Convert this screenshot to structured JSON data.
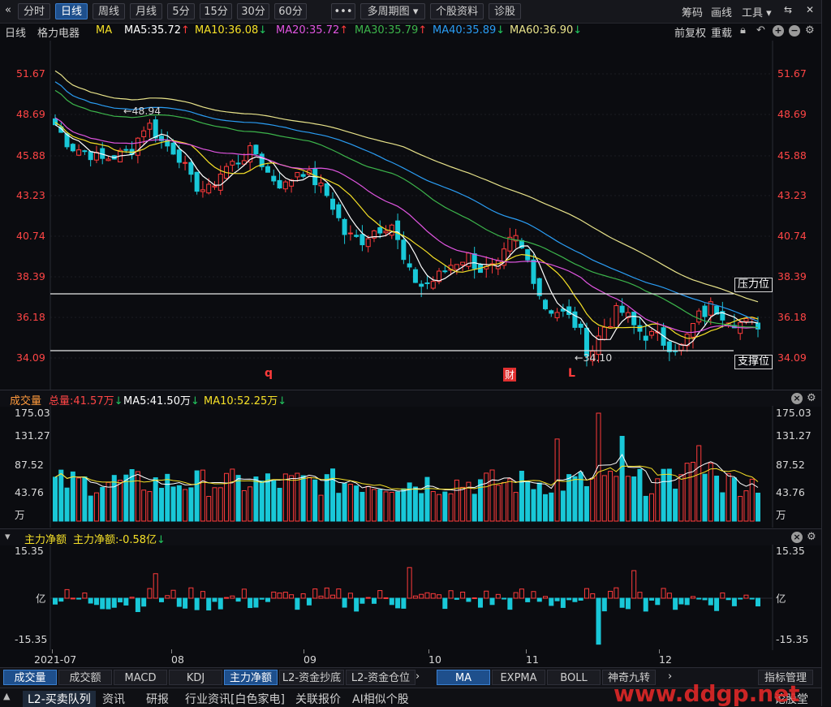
{
  "toolbar": {
    "back_icon": "«",
    "period_buttons": [
      "分时",
      "日线",
      "周线",
      "月线",
      "5分",
      "15分",
      "30分",
      "60分"
    ],
    "more_label": "•••",
    "multi_period_label": "多周期图",
    "stock_info_label": "个股资料",
    "diagnose_label": "诊股",
    "chips_label": "筹码",
    "draw_label": "画线",
    "tools_label": "工具",
    "active_period": "日线"
  },
  "ma_bar": {
    "period": "日线",
    "stock_name": "格力电器",
    "ma_label": "MA",
    "ma5": "MA5:35.72",
    "ma10": "MA10:36.08",
    "ma20": "MA20:35.72",
    "ma30": "MA30:35.79",
    "ma40": "MA40:35.89",
    "ma60": "MA60:36.90",
    "adjust_label": "前复权",
    "overlay_label": "重载",
    "colors": {
      "ma5": "#ffffff",
      "ma10": "#f5e027",
      "ma20": "#e055e0",
      "ma30": "#3cb44b",
      "ma40": "#2a9df4",
      "ma60": "#e8e38a"
    }
  },
  "price_axis": [
    "51.67",
    "48.69",
    "45.88",
    "43.23",
    "40.74",
    "38.39",
    "36.18",
    "34.09"
  ],
  "annotations": {
    "high_label": "←48.94",
    "low_label": "←34.10",
    "resistance_label": "压力位",
    "support_label": "支撑位",
    "marker_q": "q",
    "marker_cai": "财",
    "marker_L": "L"
  },
  "volume_panel": {
    "title": "成交量",
    "total": "总量:41.57万",
    "ma5": "MA5:41.50万",
    "ma10": "MA10:52.25万",
    "axis": [
      "175.03",
      "131.27",
      "87.52",
      "43.76",
      "万"
    ]
  },
  "flow_panel": {
    "title": "主力净额",
    "value": "主力净额:-0.58亿",
    "axis": [
      "15.35",
      "亿",
      "-15.35"
    ]
  },
  "date_axis": [
    "2021-07",
    "08",
    "09",
    "10",
    "11",
    "12"
  ],
  "indicator_tabs": [
    "成交量",
    "成交额",
    "MACD",
    "KDJ",
    "主力净额",
    "L2-资金抄底",
    "L2-资金仓位"
  ],
  "overlay_tabs": [
    "MA",
    "EXPMA",
    "BOLL",
    "神奇九转"
  ],
  "indicator_manage_label": "指标管理",
  "bottom_tabs": [
    "L2-买卖队列",
    "资讯",
    "研报",
    "行业资讯[白色家电]",
    "关联报价",
    "AI相似个股",
    "论股堂"
  ],
  "watermark": "www.ddgp.net",
  "chart_data": {
    "type": "candlestick",
    "title": "格力电器 日线",
    "ylim": [
      34.09,
      51.67
    ],
    "x": [
      "2021-07",
      "08",
      "09",
      "10",
      "11",
      "12"
    ],
    "approx_closes": [
      48.0,
      46.5,
      46.2,
      45.6,
      45.9,
      46.3,
      48.2,
      46.8,
      46.1,
      44.0,
      43.5,
      45.0,
      45.6,
      46.3,
      44.6,
      43.8,
      45.1,
      44.2,
      43.0,
      40.8,
      40.5,
      41.2,
      41.6,
      38.7,
      37.9,
      38.3,
      39.2,
      39.6,
      38.7,
      38.9,
      40.8,
      39.2,
      36.8,
      36.5,
      35.9,
      34.3,
      35.8,
      36.6,
      35.6,
      35.2,
      34.9,
      34.6,
      36.1,
      36.8,
      36.3,
      35.8,
      35.9
    ]
  }
}
